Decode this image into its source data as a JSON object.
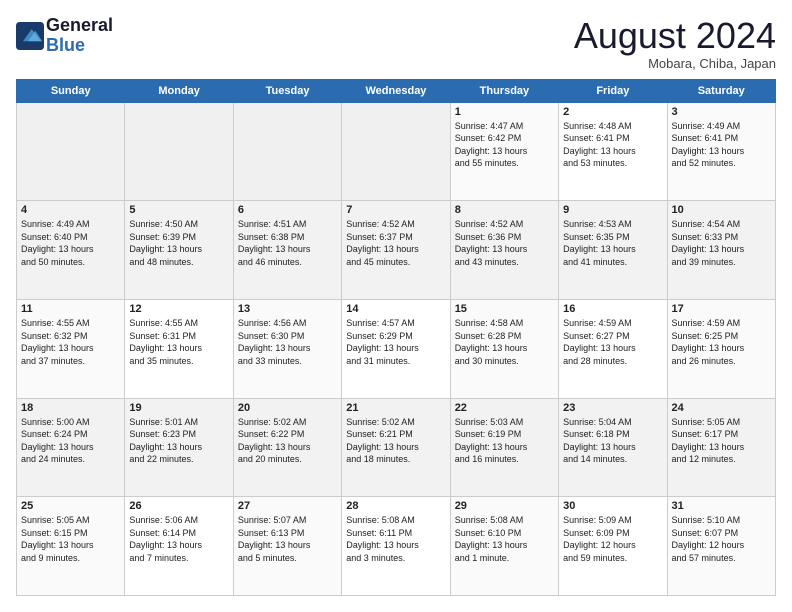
{
  "logo": {
    "line1": "General",
    "line2": "Blue"
  },
  "header": {
    "title": "August 2024",
    "subtitle": "Mobara, Chiba, Japan"
  },
  "weekdays": [
    "Sunday",
    "Monday",
    "Tuesday",
    "Wednesday",
    "Thursday",
    "Friday",
    "Saturday"
  ],
  "weeks": [
    [
      {
        "day": "",
        "info": ""
      },
      {
        "day": "",
        "info": ""
      },
      {
        "day": "",
        "info": ""
      },
      {
        "day": "",
        "info": ""
      },
      {
        "day": "1",
        "info": "Sunrise: 4:47 AM\nSunset: 6:42 PM\nDaylight: 13 hours\nand 55 minutes."
      },
      {
        "day": "2",
        "info": "Sunrise: 4:48 AM\nSunset: 6:41 PM\nDaylight: 13 hours\nand 53 minutes."
      },
      {
        "day": "3",
        "info": "Sunrise: 4:49 AM\nSunset: 6:41 PM\nDaylight: 13 hours\nand 52 minutes."
      }
    ],
    [
      {
        "day": "4",
        "info": "Sunrise: 4:49 AM\nSunset: 6:40 PM\nDaylight: 13 hours\nand 50 minutes."
      },
      {
        "day": "5",
        "info": "Sunrise: 4:50 AM\nSunset: 6:39 PM\nDaylight: 13 hours\nand 48 minutes."
      },
      {
        "day": "6",
        "info": "Sunrise: 4:51 AM\nSunset: 6:38 PM\nDaylight: 13 hours\nand 46 minutes."
      },
      {
        "day": "7",
        "info": "Sunrise: 4:52 AM\nSunset: 6:37 PM\nDaylight: 13 hours\nand 45 minutes."
      },
      {
        "day": "8",
        "info": "Sunrise: 4:52 AM\nSunset: 6:36 PM\nDaylight: 13 hours\nand 43 minutes."
      },
      {
        "day": "9",
        "info": "Sunrise: 4:53 AM\nSunset: 6:35 PM\nDaylight: 13 hours\nand 41 minutes."
      },
      {
        "day": "10",
        "info": "Sunrise: 4:54 AM\nSunset: 6:33 PM\nDaylight: 13 hours\nand 39 minutes."
      }
    ],
    [
      {
        "day": "11",
        "info": "Sunrise: 4:55 AM\nSunset: 6:32 PM\nDaylight: 13 hours\nand 37 minutes."
      },
      {
        "day": "12",
        "info": "Sunrise: 4:55 AM\nSunset: 6:31 PM\nDaylight: 13 hours\nand 35 minutes."
      },
      {
        "day": "13",
        "info": "Sunrise: 4:56 AM\nSunset: 6:30 PM\nDaylight: 13 hours\nand 33 minutes."
      },
      {
        "day": "14",
        "info": "Sunrise: 4:57 AM\nSunset: 6:29 PM\nDaylight: 13 hours\nand 31 minutes."
      },
      {
        "day": "15",
        "info": "Sunrise: 4:58 AM\nSunset: 6:28 PM\nDaylight: 13 hours\nand 30 minutes."
      },
      {
        "day": "16",
        "info": "Sunrise: 4:59 AM\nSunset: 6:27 PM\nDaylight: 13 hours\nand 28 minutes."
      },
      {
        "day": "17",
        "info": "Sunrise: 4:59 AM\nSunset: 6:25 PM\nDaylight: 13 hours\nand 26 minutes."
      }
    ],
    [
      {
        "day": "18",
        "info": "Sunrise: 5:00 AM\nSunset: 6:24 PM\nDaylight: 13 hours\nand 24 minutes."
      },
      {
        "day": "19",
        "info": "Sunrise: 5:01 AM\nSunset: 6:23 PM\nDaylight: 13 hours\nand 22 minutes."
      },
      {
        "day": "20",
        "info": "Sunrise: 5:02 AM\nSunset: 6:22 PM\nDaylight: 13 hours\nand 20 minutes."
      },
      {
        "day": "21",
        "info": "Sunrise: 5:02 AM\nSunset: 6:21 PM\nDaylight: 13 hours\nand 18 minutes."
      },
      {
        "day": "22",
        "info": "Sunrise: 5:03 AM\nSunset: 6:19 PM\nDaylight: 13 hours\nand 16 minutes."
      },
      {
        "day": "23",
        "info": "Sunrise: 5:04 AM\nSunset: 6:18 PM\nDaylight: 13 hours\nand 14 minutes."
      },
      {
        "day": "24",
        "info": "Sunrise: 5:05 AM\nSunset: 6:17 PM\nDaylight: 13 hours\nand 12 minutes."
      }
    ],
    [
      {
        "day": "25",
        "info": "Sunrise: 5:05 AM\nSunset: 6:15 PM\nDaylight: 13 hours\nand 9 minutes."
      },
      {
        "day": "26",
        "info": "Sunrise: 5:06 AM\nSunset: 6:14 PM\nDaylight: 13 hours\nand 7 minutes."
      },
      {
        "day": "27",
        "info": "Sunrise: 5:07 AM\nSunset: 6:13 PM\nDaylight: 13 hours\nand 5 minutes."
      },
      {
        "day": "28",
        "info": "Sunrise: 5:08 AM\nSunset: 6:11 PM\nDaylight: 13 hours\nand 3 minutes."
      },
      {
        "day": "29",
        "info": "Sunrise: 5:08 AM\nSunset: 6:10 PM\nDaylight: 13 hours\nand 1 minute."
      },
      {
        "day": "30",
        "info": "Sunrise: 5:09 AM\nSunset: 6:09 PM\nDaylight: 12 hours\nand 59 minutes."
      },
      {
        "day": "31",
        "info": "Sunrise: 5:10 AM\nSunset: 6:07 PM\nDaylight: 12 hours\nand 57 minutes."
      }
    ]
  ]
}
